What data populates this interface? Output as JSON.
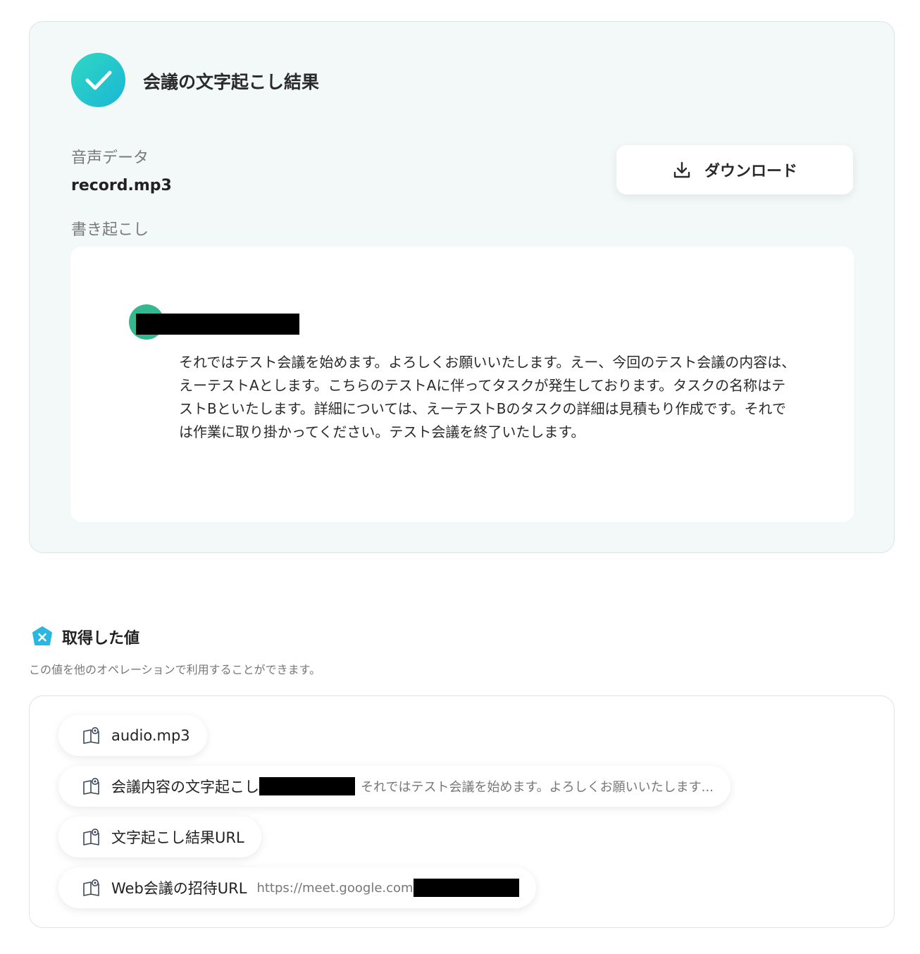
{
  "result": {
    "title": "会議の文字起こし結果",
    "audio_label": "音声データ",
    "audio_value": "record.mp3",
    "transcript_label": "書き起こし",
    "download_label": "ダウンロード",
    "transcript_text": "それではテスト会議を始めます。よろしくお願いいたします。えー、今回のテスト会議の内容は、えーテストAとします。こちらのテストAに伴ってタスクが発生しております。タスクの名称はテストBといたします。詳細については、えーテストBのタスクの詳細は見積もり作成です。それでは作業に取り掛かってください。テスト会議を終了いたします。"
  },
  "values": {
    "title": "取得した値",
    "description": "この値を他のオペレーションで利用することができます。",
    "items": [
      {
        "label": "audio.mp3",
        "preview": ""
      },
      {
        "label": "会議内容の文字起こし",
        "preview": "それではテスト会議を始めます。よろしくお願いいたします..."
      },
      {
        "label": "文字起こし結果URL",
        "preview": ""
      },
      {
        "label": "Web会議の招待URL",
        "preview": "https://meet.google.com"
      }
    ]
  },
  "colors": {
    "accent_teal": "#1bb6d6",
    "speaker_green": "#35b88f",
    "card_background": "#f3f8f8"
  },
  "icons": {
    "check": "check-icon",
    "download": "download-icon",
    "variable": "variable-icon",
    "book": "book-icon"
  }
}
